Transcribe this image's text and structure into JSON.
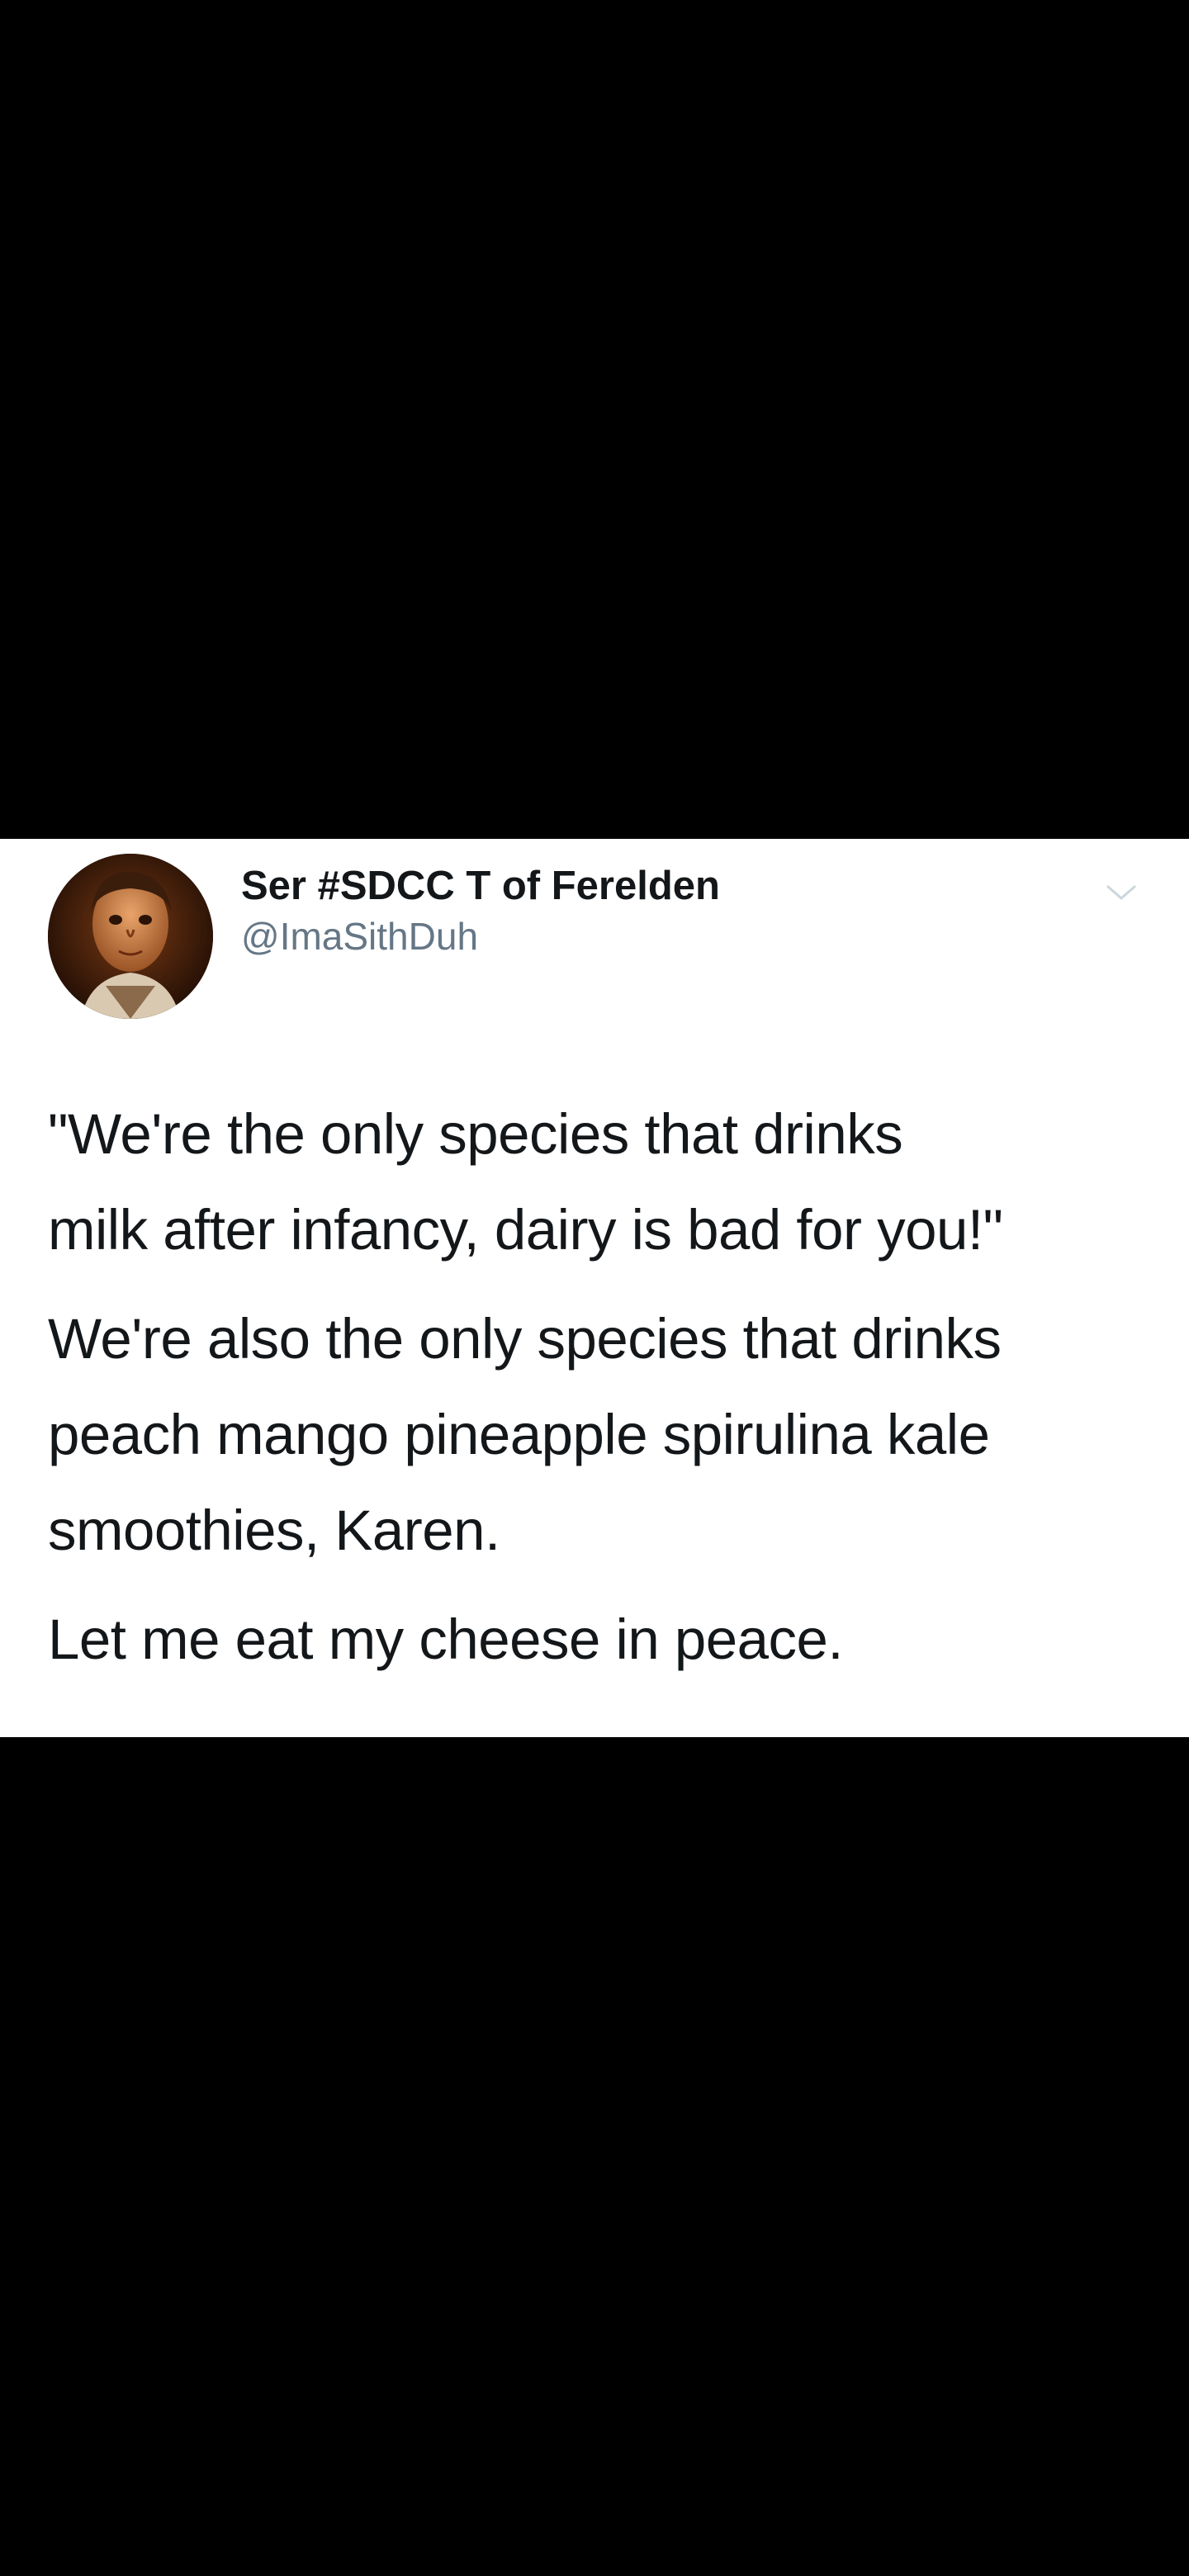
{
  "tweet": {
    "display_name": "Ser #SDCC T of Ferelden",
    "handle": "@ImaSithDuh",
    "avatar_icon": "user-avatar-photo",
    "menu_icon": "chevron-down-icon",
    "paragraphs": [
      "\"We're the only species that drinks\nmilk after infancy, dairy is bad for you!\"",
      "We're also the only species that drinks\npeach mango pineapple spirulina kale\nsmoothies, Karen.",
      "Let me eat my cheese in peace."
    ]
  }
}
